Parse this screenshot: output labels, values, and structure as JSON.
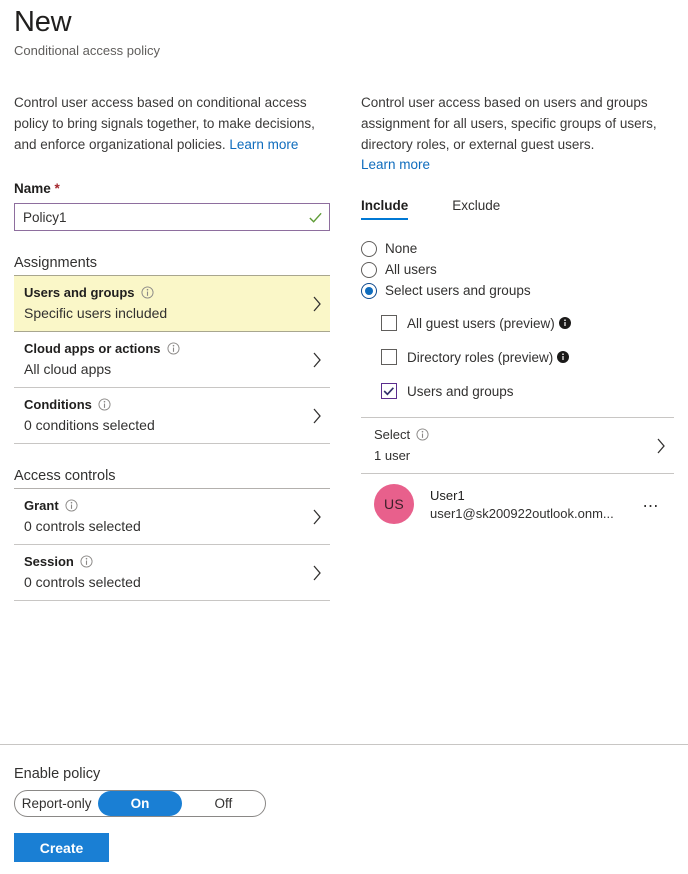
{
  "header": {
    "title": "New",
    "subtitle": "Conditional access policy"
  },
  "left": {
    "blurb": "Control user access based on conditional access policy to bring signals together, to make decisions, and enforce organizational policies. ",
    "learn_more": "Learn more",
    "name_label": "Name",
    "name_required_mark": "*",
    "name_value": "Policy1",
    "name_placeholder": "",
    "assignments_heading": "Assignments",
    "access_controls_heading": "Access controls",
    "assignment_rows": [
      {
        "title": "Users and groups",
        "subtitle": "Specific users included"
      },
      {
        "title": "Cloud apps or actions",
        "subtitle": "All cloud apps"
      },
      {
        "title": "Conditions",
        "subtitle": "0 conditions selected"
      }
    ],
    "control_rows": [
      {
        "title": "Grant",
        "subtitle": "0 controls selected"
      },
      {
        "title": "Session",
        "subtitle": "0 controls selected"
      }
    ]
  },
  "right": {
    "blurb": "Control user access based on users and groups assignment for all users, specific groups of users, directory roles, or external guest users.",
    "learn_more": "Learn more",
    "tabs": [
      {
        "label": "Include"
      },
      {
        "label": "Exclude"
      }
    ],
    "radios": [
      {
        "label": "None"
      },
      {
        "label": "All users"
      },
      {
        "label": "Select users and groups"
      }
    ],
    "checkboxes": [
      {
        "label": "All guest users (preview)"
      },
      {
        "label": "Directory roles (preview)"
      },
      {
        "label": "Users and groups"
      }
    ],
    "select_row": {
      "title": "Select",
      "subtitle": "1 user"
    },
    "user": {
      "initials": "US",
      "name": "User1",
      "email": "user1@sk200922outlook.onm..."
    }
  },
  "footer": {
    "enable_label": "Enable policy",
    "toggle_options": [
      "Report-only",
      "On",
      "Off"
    ],
    "create_label": "Create"
  },
  "colors": {
    "accent_blue": "#0078d4",
    "link_blue": "#0f6cbd",
    "highlight_yellow": "#faf7c8",
    "avatar_pink": "#e8608c",
    "input_border_purple": "#8e6e9e",
    "check_green": "#4f8a2b",
    "required_red": "#a4262c"
  }
}
